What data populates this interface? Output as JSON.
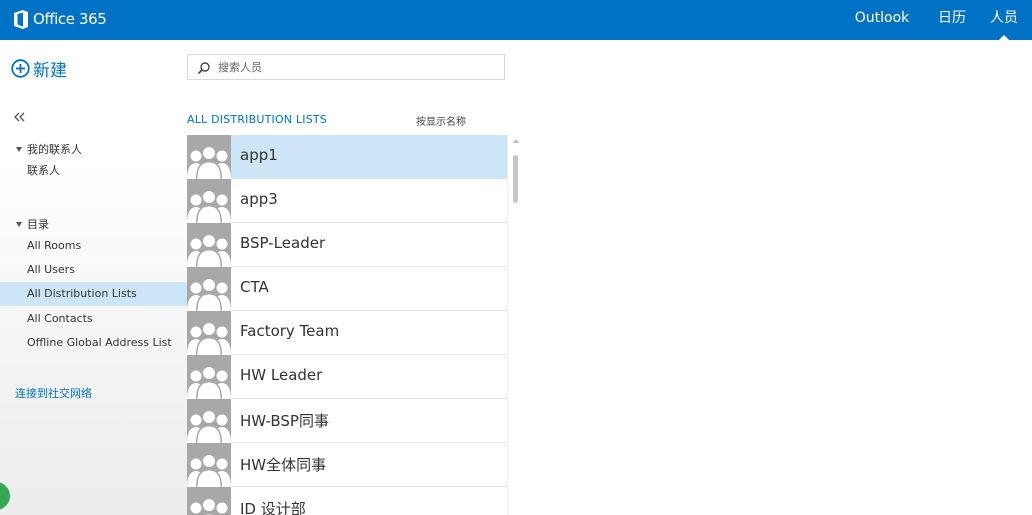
{
  "header": {
    "brand": "Office 365",
    "nav": [
      {
        "label": "Outlook"
      },
      {
        "label": "日历"
      },
      {
        "label": "人员"
      }
    ],
    "active_nav": "人员",
    "bg_color": "#0072c6"
  },
  "sidebar": {
    "new_label": "新建",
    "collapse_icon": "double-chevron-left-icon",
    "groups": [
      {
        "label": "我的联系人",
        "items": [
          "联系人"
        ]
      },
      {
        "label": "目录",
        "items": [
          "All Rooms",
          "All Users",
          "All Distribution Lists",
          "All Contacts",
          "Offline Global Address List"
        ]
      }
    ],
    "selected_item": "All Distribution Lists",
    "social_link": "连接到社交网络"
  },
  "search": {
    "placeholder": "搜索人员",
    "value": ""
  },
  "list": {
    "title": "ALL DISTRIBUTION LISTS",
    "sort_label": "按显示名称",
    "selected": "app1",
    "items": [
      "app1",
      "app3",
      "BSP-Leader",
      "CTA",
      "Factory Team",
      "HW Leader",
      "HW-BSP同事",
      "HW全体同事",
      "ID 设计部"
    ]
  },
  "colors": {
    "accent": "#0072c6",
    "selected_bg": "#cde6f7",
    "avatar_bg": "#a8a8a8"
  }
}
